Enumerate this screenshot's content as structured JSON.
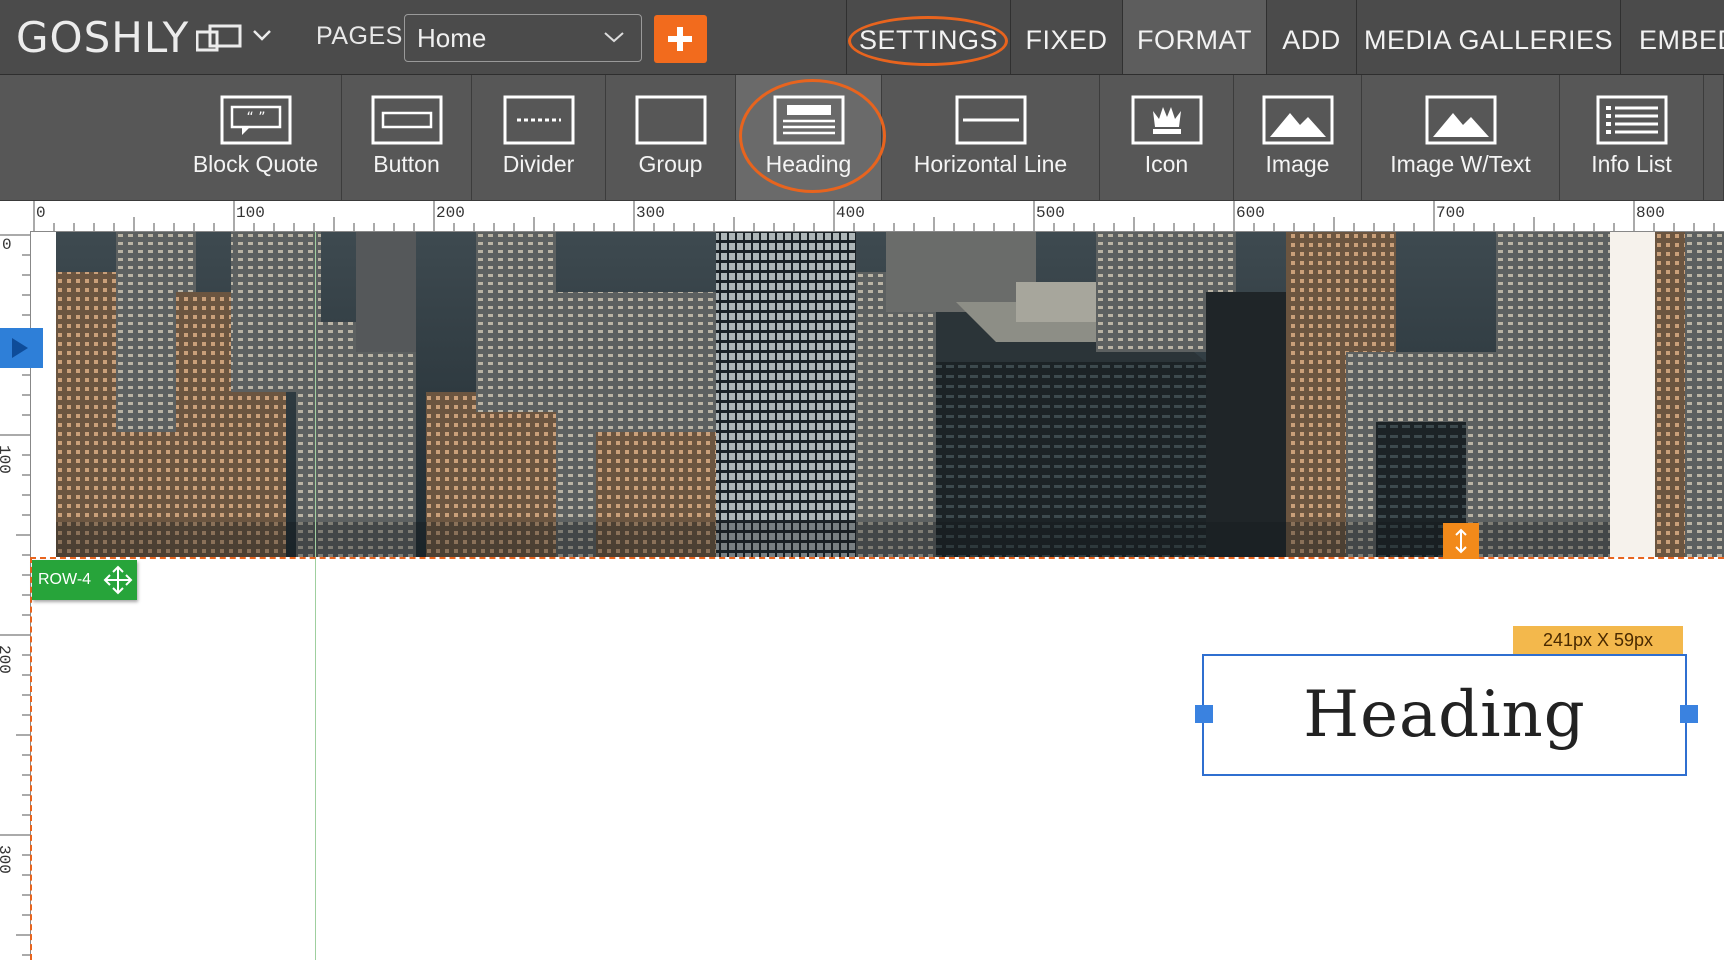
{
  "app": {
    "logo_text": "GOSHLY",
    "pages_label": "PAGES",
    "page_select_value": "Home"
  },
  "tabs": [
    {
      "label": "SETTINGS",
      "highlighted": true
    },
    {
      "label": "FIXED"
    },
    {
      "label": "FORMAT",
      "active": true
    },
    {
      "label": "ADD"
    },
    {
      "label": "MEDIA GALLERIES"
    },
    {
      "label": "EMBED"
    }
  ],
  "tools": [
    {
      "label": "Block Quote",
      "icon": "block-quote-icon"
    },
    {
      "label": "Button",
      "icon": "button-icon"
    },
    {
      "label": "Divider",
      "icon": "divider-icon"
    },
    {
      "label": "Group",
      "icon": "group-icon"
    },
    {
      "label": "Heading",
      "icon": "heading-icon",
      "highlighted": true
    },
    {
      "label": "Horizontal Line",
      "icon": "horizontal-line-icon"
    },
    {
      "label": "Icon",
      "icon": "icon-icon"
    },
    {
      "label": "Image",
      "icon": "image-icon"
    },
    {
      "label": "Image W/Text",
      "icon": "image-with-text-icon"
    },
    {
      "label": "Info List",
      "icon": "info-list-icon"
    }
  ],
  "ruler": {
    "horizontal_labels": [
      "0",
      "100",
      "200",
      "300",
      "400",
      "500",
      "600",
      "700",
      "800"
    ],
    "vertical_labels": [
      "0",
      "100",
      "200",
      "300"
    ]
  },
  "canvas": {
    "row_label": "ROW-4",
    "element_size": "241px X 59px",
    "heading_text": "Heading"
  },
  "colors": {
    "accent_orange": "#e8641e",
    "add_button": "#f26b1d",
    "row_badge": "#27a43a",
    "selection_blue": "#2f6fd0",
    "size_badge": "#f3b84c"
  }
}
